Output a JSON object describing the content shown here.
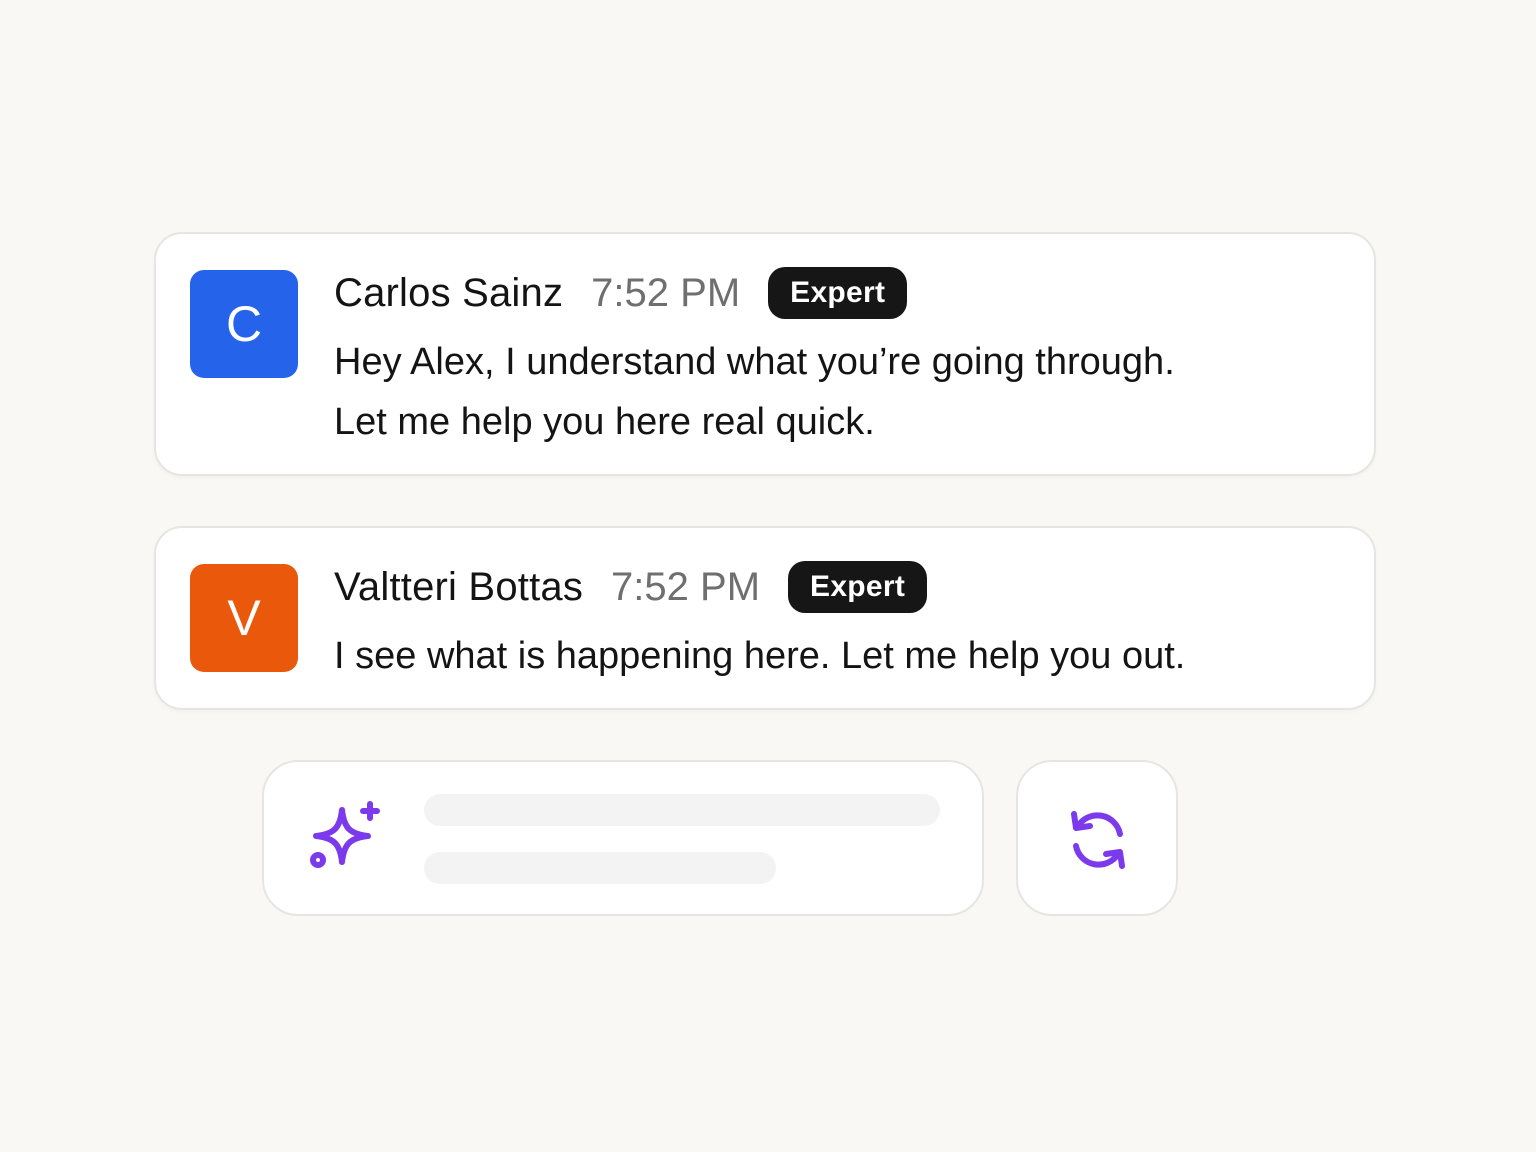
{
  "messages": [
    {
      "initial": "C",
      "avatar_color": "#2563eb",
      "name": "Carlos Sainz",
      "time": "7:52 PM",
      "badge": "Expert",
      "text_lines": [
        "Hey Alex, I understand what you’re going through.",
        "Let me help you here real quick."
      ]
    },
    {
      "initial": "V",
      "avatar_color": "#ea580c",
      "name": "Valtteri Bottas",
      "time": "7:52 PM",
      "badge": "Expert",
      "text_lines": [
        "I see what is happening here. Let me help you out."
      ]
    }
  ],
  "ai_suggestion": {
    "icon": "sparkle-icon",
    "state": "loading",
    "accent_color": "#7c3aed"
  },
  "refresh": {
    "icon": "refresh-icon",
    "accent_color": "#7c3aed"
  },
  "colors": {
    "background": "#f9f8f5",
    "card_border": "#e6e5e2",
    "badge_bg": "#161616"
  }
}
